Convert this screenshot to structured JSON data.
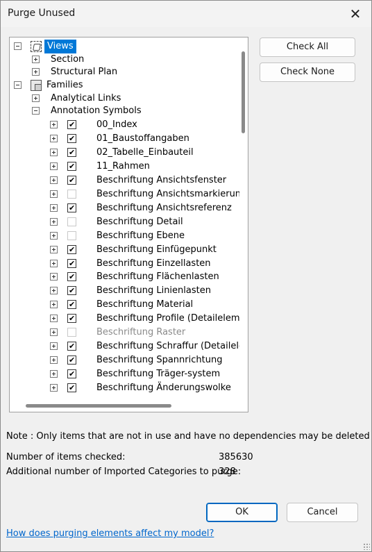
{
  "window": {
    "title": "Purge Unused"
  },
  "tree": {
    "views": {
      "label": "Views",
      "children": [
        "Section",
        "Structural Plan"
      ]
    },
    "families": {
      "label": "Families",
      "children": [
        "Analytical Links",
        "Annotation Symbols"
      ]
    },
    "annotation_items": [
      {
        "label": "00_Index",
        "checked": true,
        "enabled": true
      },
      {
        "label": "01_Baustoffangaben",
        "checked": true,
        "enabled": true
      },
      {
        "label": "02_Tabelle_Einbauteil",
        "checked": true,
        "enabled": true
      },
      {
        "label": "11_Rahmen",
        "checked": true,
        "enabled": true
      },
      {
        "label": "Beschriftung Ansichtsfenster",
        "checked": true,
        "enabled": true
      },
      {
        "label": "Beschriftung Ansichtsmarkierung",
        "checked": false,
        "enabled": true
      },
      {
        "label": "Beschriftung Ansichtsreferenz",
        "checked": true,
        "enabled": true
      },
      {
        "label": "Beschriftung Detail",
        "checked": false,
        "enabled": true
      },
      {
        "label": "Beschriftung Ebene",
        "checked": false,
        "enabled": true
      },
      {
        "label": "Beschriftung Einfügepunkt",
        "checked": true,
        "enabled": true
      },
      {
        "label": "Beschriftung Einzellasten",
        "checked": true,
        "enabled": true
      },
      {
        "label": "Beschriftung Flächenlasten",
        "checked": true,
        "enabled": true
      },
      {
        "label": "Beschriftung Linienlasten",
        "checked": true,
        "enabled": true
      },
      {
        "label": "Beschriftung Material",
        "checked": true,
        "enabled": true
      },
      {
        "label": "Beschriftung Profile (Detailelem…",
        "checked": true,
        "enabled": true
      },
      {
        "label": "Beschriftung Raster",
        "checked": false,
        "enabled": false
      },
      {
        "label": "Beschriftung Schraffur (Detailelem",
        "checked": true,
        "enabled": true
      },
      {
        "label": "Beschriftung Spannrichtung",
        "checked": true,
        "enabled": true
      },
      {
        "label": "Beschriftung Träger-system",
        "checked": true,
        "enabled": true
      },
      {
        "label": "Beschriftung Änderungswolke",
        "checked": true,
        "enabled": true
      }
    ]
  },
  "buttons": {
    "check_all": "Check All",
    "check_none": "Check None",
    "ok": "OK",
    "cancel": "Cancel"
  },
  "note": "Note : Only items that are not in use and have no dependencies may be deleted",
  "stats": {
    "checked_label": "Number of items checked:",
    "checked_value": "385630",
    "imported_label": "Additional number of Imported Categories to purge:",
    "imported_value": "328"
  },
  "help_link": "How does purging elements affect my model?",
  "colors": {
    "selection": "#0078d7",
    "link": "#0066cc"
  }
}
